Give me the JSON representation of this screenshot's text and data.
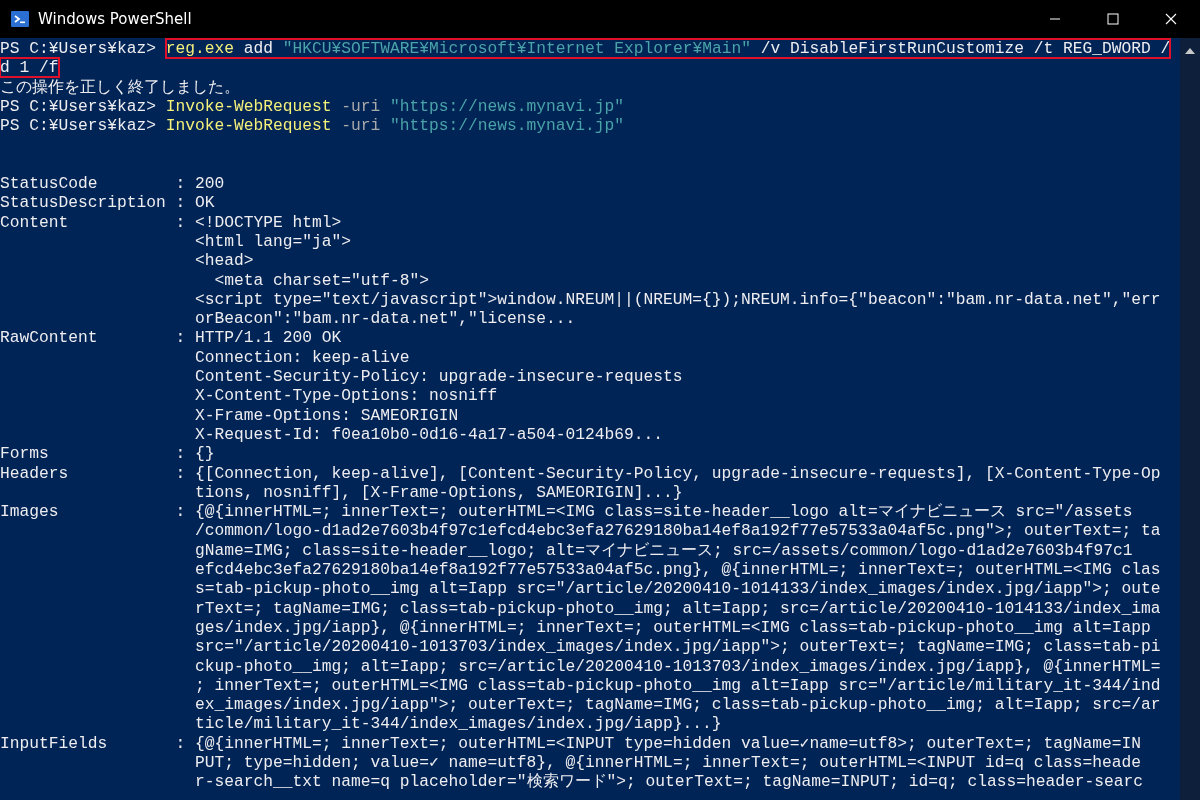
{
  "window": {
    "title": "Windows PowerShell"
  },
  "lines": [
    {
      "highlighted": true,
      "segments": [
        {
          "kind": "prompt",
          "text": "PS C:¥Users¥kaz> "
        },
        {
          "kind": "command",
          "text": "reg.exe"
        },
        {
          "kind": "plain",
          "text": " add "
        },
        {
          "kind": "string",
          "text": "\"HKCU¥SOFTWARE¥Microsoft¥Internet Explorer¥Main\""
        },
        {
          "kind": "plain",
          "text": " /v DisableFirstRunCustomize /t REG_DWORD /"
        }
      ]
    },
    {
      "highlighted": true,
      "segments": [
        {
          "kind": "plain",
          "text": "d 1 /f"
        }
      ]
    },
    {
      "highlighted": false,
      "segments": [
        {
          "kind": "plain",
          "text": "この操作を正しく終了しました。"
        }
      ]
    },
    {
      "highlighted": false,
      "segments": [
        {
          "kind": "prompt",
          "text": "PS C:¥Users¥kaz> "
        },
        {
          "kind": "command",
          "text": "Invoke-WebRequest"
        },
        {
          "kind": "parameter",
          "text": " -uri "
        },
        {
          "kind": "string",
          "text": "\"https://news.mynavi.jp\""
        }
      ]
    },
    {
      "highlighted": false,
      "segments": [
        {
          "kind": "prompt",
          "text": "PS C:¥Users¥kaz> "
        },
        {
          "kind": "command",
          "text": "Invoke-WebRequest"
        },
        {
          "kind": "parameter",
          "text": " -uri "
        },
        {
          "kind": "string",
          "text": "\"https://news.mynavi.jp\""
        }
      ]
    }
  ],
  "properties": [
    {
      "name": "StatusCode",
      "separator": ":",
      "values": [
        "200"
      ]
    },
    {
      "name": "StatusDescription",
      "separator": ":",
      "values": [
        "OK"
      ]
    },
    {
      "name": "Content",
      "separator": ":",
      "values": [
        "<!DOCTYPE html>",
        "<html lang=\"ja\">",
        "<head>",
        "  <meta charset=\"utf-8\">",
        "<script type=\"text/javascript\">window.NREUM||(NREUM={});NREUM.info={\"beacon\":\"bam.nr-data.net\",\"err",
        "orBeacon\":\"bam.nr-data.net\",\"license..."
      ]
    },
    {
      "name": "RawContent",
      "separator": ":",
      "values": [
        "HTTP/1.1 200 OK",
        "Connection: keep-alive",
        "Content-Security-Policy: upgrade-insecure-requests",
        "X-Content-Type-Options: nosniff",
        "X-Frame-Options: SAMEORIGIN",
        "X-Request-Id: f0ea10b0-0d16-4a17-a504-0124b69..."
      ]
    },
    {
      "name": "Forms",
      "separator": ":",
      "values": [
        "{}"
      ]
    },
    {
      "name": "Headers",
      "separator": ":",
      "values": [
        "{[Connection, keep-alive], [Content-Security-Policy, upgrade-insecure-requests], [X-Content-Type-Op",
        "tions, nosniff], [X-Frame-Options, SAMEORIGIN]...}"
      ]
    },
    {
      "name": "Images",
      "separator": ":",
      "values": [
        "{@{innerHTML=; innerText=; outerHTML=<IMG class=site-header__logo alt=マイナビニュース src=\"/assets",
        "/common/logo-d1ad2e7603b4f97c1efcd4ebc3efa27629180ba14ef8a192f77e57533a04af5c.png\">; outerText=; ta",
        "gName=IMG; class=site-header__logo; alt=マイナビニュース; src=/assets/common/logo-d1ad2e7603b4f97c1",
        "efcd4ebc3efa27629180ba14ef8a192f77e57533a04af5c.png}, @{innerHTML=; innerText=; outerHTML=<IMG clas",
        "s=tab-pickup-photo__img alt=Iapp src=\"/article/20200410-1014133/index_images/index.jpg/iapp\">; oute",
        "rText=; tagName=IMG; class=tab-pickup-photo__img; alt=Iapp; src=/article/20200410-1014133/index_ima",
        "ges/index.jpg/iapp}, @{innerHTML=; innerText=; outerHTML=<IMG class=tab-pickup-photo__img alt=Iapp",
        "src=\"/article/20200410-1013703/index_images/index.jpg/iapp\">; outerText=; tagName=IMG; class=tab-pi",
        "ckup-photo__img; alt=Iapp; src=/article/20200410-1013703/index_images/index.jpg/iapp}, @{innerHTML=",
        "; innerText=; outerHTML=<IMG class=tab-pickup-photo__img alt=Iapp src=\"/article/military_it-344/ind",
        "ex_images/index.jpg/iapp\">; outerText=; tagName=IMG; class=tab-pickup-photo__img; alt=Iapp; src=/ar",
        "ticle/military_it-344/index_images/index.jpg/iapp}...}"
      ]
    },
    {
      "name": "InputFields",
      "separator": ":",
      "values": [
        "{@{innerHTML=; innerText=; outerHTML=<INPUT type=hidden value=✓name=utf8>; outerText=; tagName=IN",
        "PUT; type=hidden; value=✓ name=utf8}, @{innerHTML=; innerText=; outerHTML=<INPUT id=q class=heade",
        "r-search__txt name=q placeholder=\"検索ワード\">; outerText=; tagName=INPUT; id=q; class=header-searc"
      ]
    }
  ]
}
